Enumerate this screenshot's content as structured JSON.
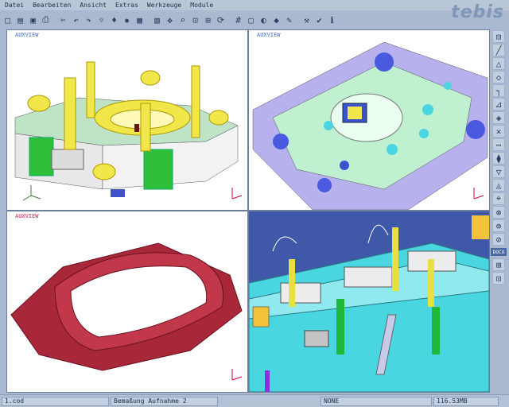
{
  "app": {
    "brand": "tebis"
  },
  "menu": [
    "Datei",
    "Bearbeiten",
    "Ansicht",
    "Extras",
    "Werkzeuge",
    "Module"
  ],
  "toolbar_icons": [
    "new-file-icon",
    "open-file-icon",
    "save-icon",
    "print-icon",
    "cut-icon",
    "undo-icon",
    "redo-icon",
    "light-icon",
    "bulb-icon",
    "settings-icon",
    "box-icon",
    "layers-icon",
    "pan-icon",
    "zoom-icon",
    "zoom-window-icon",
    "fit-icon",
    "rotate-icon",
    "grid-icon",
    "frame-icon",
    "shade-icon",
    "render-icon",
    "measure-icon",
    "wrench-icon",
    "check-icon",
    "info-icon"
  ],
  "toolbar_glyphs": [
    "□",
    "▤",
    "▣",
    "⎙",
    "✂",
    "↶",
    "↷",
    "☼",
    "♦",
    "✹",
    "▦",
    "▧",
    "✥",
    "⌕",
    "⊡",
    "⊞",
    "⟳",
    "#",
    "▢",
    "◐",
    "◆",
    "✎",
    "⚒",
    "✔",
    "ℹ"
  ],
  "sidebar_icons": [
    "s1",
    "s2",
    "s3",
    "s4",
    "s5",
    "s6",
    "s7",
    "s8",
    "s9",
    "s10",
    "s11",
    "s12",
    "s13",
    "s14",
    "s15",
    "s16"
  ],
  "sidebar_glyphs": [
    "⊟",
    "╱",
    "△",
    "◇",
    "┐",
    "⊿",
    "◈",
    "✕",
    "⋯",
    "⧫",
    "▽",
    "◬",
    "⌖",
    "⊗",
    "⊜",
    "⊘"
  ],
  "sidebar_tag": "DOCU",
  "sidebar_bottom_glyphs": [
    "⊞",
    "⊡"
  ],
  "viewports": [
    {
      "label": "AUXVIEW"
    },
    {
      "label": "AUXVIEW"
    },
    {
      "label": "AUXVIEW"
    },
    {
      "label": ""
    }
  ],
  "colors": {
    "background": "#aab9cf",
    "viewport_bg": "#ffffff",
    "viewport_bg_dark": "#3f58a8",
    "part_red": "#a8283a",
    "yellow": "#f1e64a",
    "green": "#1fb83b",
    "cyan": "#49d6e0",
    "lavender": "#b7b2ee",
    "mint": "#bff0cf"
  },
  "status": {
    "file": "1.cod",
    "message": "Bemaßung Aufnahme 2",
    "mode": "NONE",
    "memory": "116.53MB"
  }
}
